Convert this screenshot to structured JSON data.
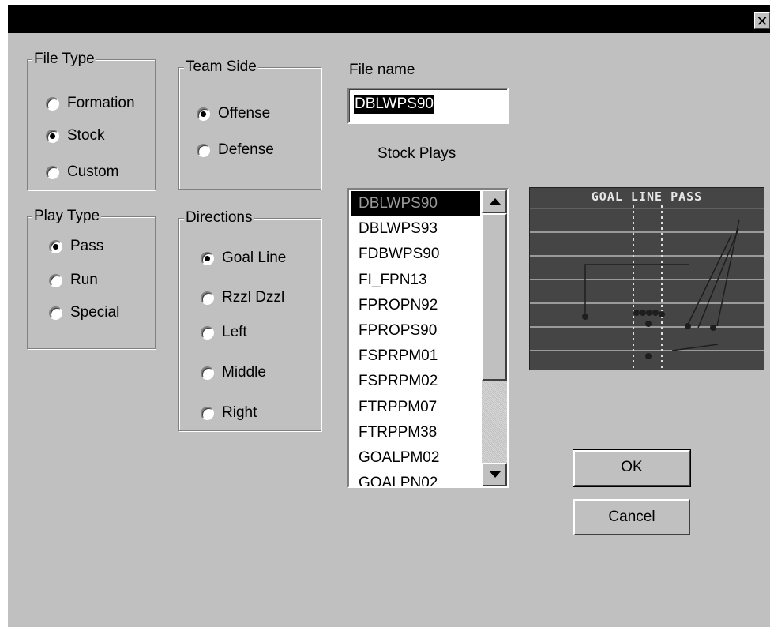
{
  "window": {
    "close_glyph": "✕"
  },
  "file_type": {
    "title": "File Type",
    "options": [
      {
        "label": "Formation",
        "selected": false
      },
      {
        "label": "Stock",
        "selected": true
      },
      {
        "label": "Custom",
        "selected": false
      }
    ]
  },
  "team_side": {
    "title": "Team Side",
    "options": [
      {
        "label": "Offense",
        "selected": true
      },
      {
        "label": "Defense",
        "selected": false
      }
    ]
  },
  "play_type": {
    "title": "Play Type",
    "options": [
      {
        "label": "Pass",
        "selected": true
      },
      {
        "label": "Run",
        "selected": false
      },
      {
        "label": "Special",
        "selected": false
      }
    ]
  },
  "directions": {
    "title": "Directions",
    "options": [
      {
        "label": "Goal Line",
        "selected": true
      },
      {
        "label": "Rzzl Dzzl",
        "selected": false
      },
      {
        "label": "Left",
        "selected": false
      },
      {
        "label": "Middle",
        "selected": false
      },
      {
        "label": "Right",
        "selected": false
      }
    ]
  },
  "file_name": {
    "label": "File name",
    "value": "DBLWPS90"
  },
  "stock_plays": {
    "label": "Stock Plays",
    "items": [
      "DBLWPS90",
      "DBLWPS93",
      "FDBWPS90",
      "FI_FPN13",
      "FPROPN92",
      "FPROPS90",
      "FSPRPM01",
      "FSPRPM02",
      "FTRPPM07",
      "FTRPPM38",
      "GOALPM02",
      "GOALPN02"
    ],
    "selected_index": 0
  },
  "preview": {
    "title": "GOAL LINE PASS",
    "icon": "play-diagram"
  },
  "buttons": {
    "ok": "OK",
    "cancel": "Cancel"
  },
  "colors": {
    "dialog_bg": "#c0c0c0",
    "titlebar": "#000000",
    "preview_bg": "#454545"
  }
}
